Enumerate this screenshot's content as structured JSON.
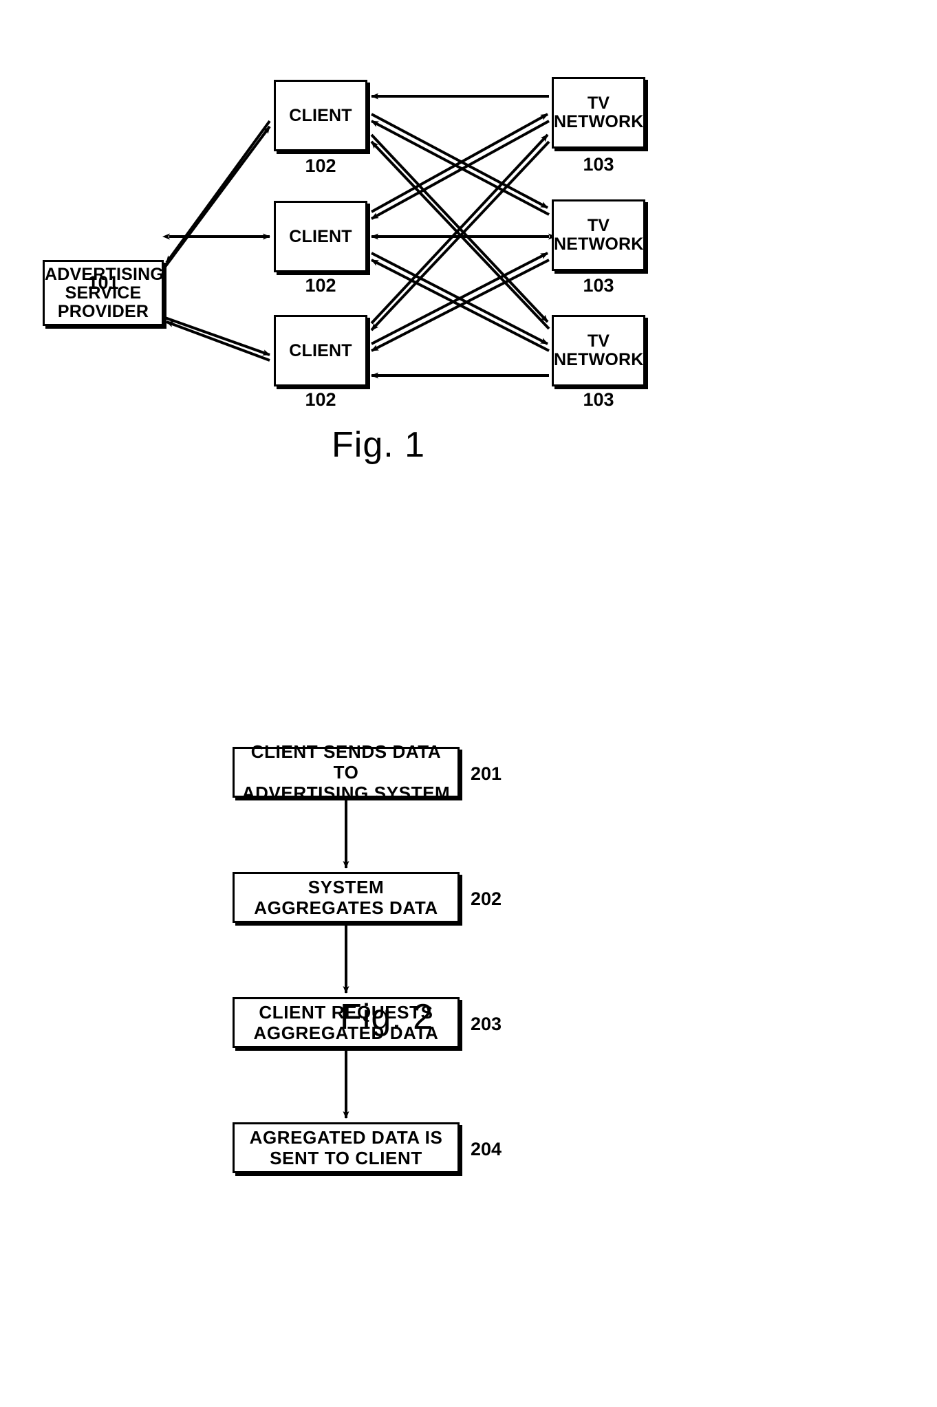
{
  "document": {
    "type": "patent-drawing-sheet",
    "background_color": "#ffffff",
    "ink_color": "#000000"
  },
  "figure1": {
    "caption": "Fig. 1",
    "nodes": {
      "advertising_service_provider": {
        "label": "ADVERTISING\nSERVICE\nPROVIDER",
        "ref": "101"
      },
      "clients": [
        {
          "label": "CLIENT",
          "ref": "102"
        },
        {
          "label": "CLIENT",
          "ref": "102"
        },
        {
          "label": "CLIENT",
          "ref": "102"
        }
      ],
      "tv_networks": [
        {
          "label": "TV\nNETWORK",
          "ref": "103"
        },
        {
          "label": "TV\nNETWORK",
          "ref": "103"
        },
        {
          "label": "TV\nNETWORK",
          "ref": "103"
        }
      ]
    },
    "connections": [
      {
        "from": "advertising_service_provider",
        "to": "client-1",
        "style": "single-arrow"
      },
      {
        "from": "advertising_service_provider",
        "to": "client-2",
        "style": "double-arrow"
      },
      {
        "from": "advertising_service_provider",
        "to": "client-3",
        "style": "single-arrow"
      },
      {
        "from": "client-1",
        "to": "advertising_service_provider",
        "style": "single-arrow"
      },
      {
        "from": "client-3",
        "to": "advertising_service_provider",
        "style": "single-arrow"
      },
      {
        "from": "tv-network-1",
        "to": "client-1",
        "style": "single-arrow"
      },
      {
        "from": "tv-network-2",
        "to": "client-1",
        "style": "single-arrow"
      },
      {
        "from": "tv-network-3",
        "to": "client-1",
        "style": "single-arrow"
      },
      {
        "from": "tv-network-1",
        "to": "client-2",
        "style": "single-arrow"
      },
      {
        "from": "tv-network-2",
        "to": "client-2",
        "style": "double-arrow"
      },
      {
        "from": "tv-network-3",
        "to": "client-2",
        "style": "single-arrow"
      },
      {
        "from": "tv-network-1",
        "to": "client-3",
        "style": "single-arrow"
      },
      {
        "from": "tv-network-2",
        "to": "client-3",
        "style": "single-arrow"
      },
      {
        "from": "tv-network-3",
        "to": "client-3",
        "style": "single-arrow"
      }
    ]
  },
  "figure2": {
    "caption": "Fig. 2",
    "type": "flowchart",
    "steps": [
      {
        "ref": "201",
        "label": "CLIENT  SENDS  DATA  TO\nADVERTISING  SYSTEM"
      },
      {
        "ref": "202",
        "label": "SYSTEM\nAGGREGATES  DATA"
      },
      {
        "ref": "203",
        "label": "CLIENT  REQUESTS\nAGGREGATED  DATA"
      },
      {
        "ref": "204",
        "label": "AGREGATED  DATA  IS\nSENT  TO  CLIENT"
      }
    ]
  }
}
